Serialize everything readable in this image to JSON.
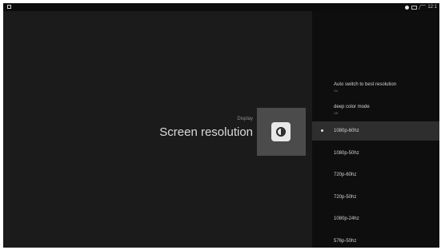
{
  "status_bar": {
    "time": "12:1"
  },
  "header": {
    "section": "Display",
    "title": "Screen resolution"
  },
  "options": [
    {
      "label": "Auto switch to best resolution",
      "sub": "On"
    },
    {
      "label": "deep color mode",
      "sub": "Off"
    }
  ],
  "resolutions": [
    {
      "label": "1080p-60hz",
      "selected": true
    },
    {
      "label": "1080p-50hz"
    },
    {
      "label": "720p-60hz"
    },
    {
      "label": "720p-50hz"
    },
    {
      "label": "1080p-24hz"
    },
    {
      "label": "576p-50hz"
    }
  ],
  "icons": {
    "app": "app-icon",
    "title": "brightness-icon",
    "selected_marker": "bullet-icon"
  },
  "colors": {
    "background": "#1b1b1b",
    "list_background": "#0e0e0e",
    "selected_row": "#2e2e2e",
    "tile": "#4b4b4b"
  }
}
